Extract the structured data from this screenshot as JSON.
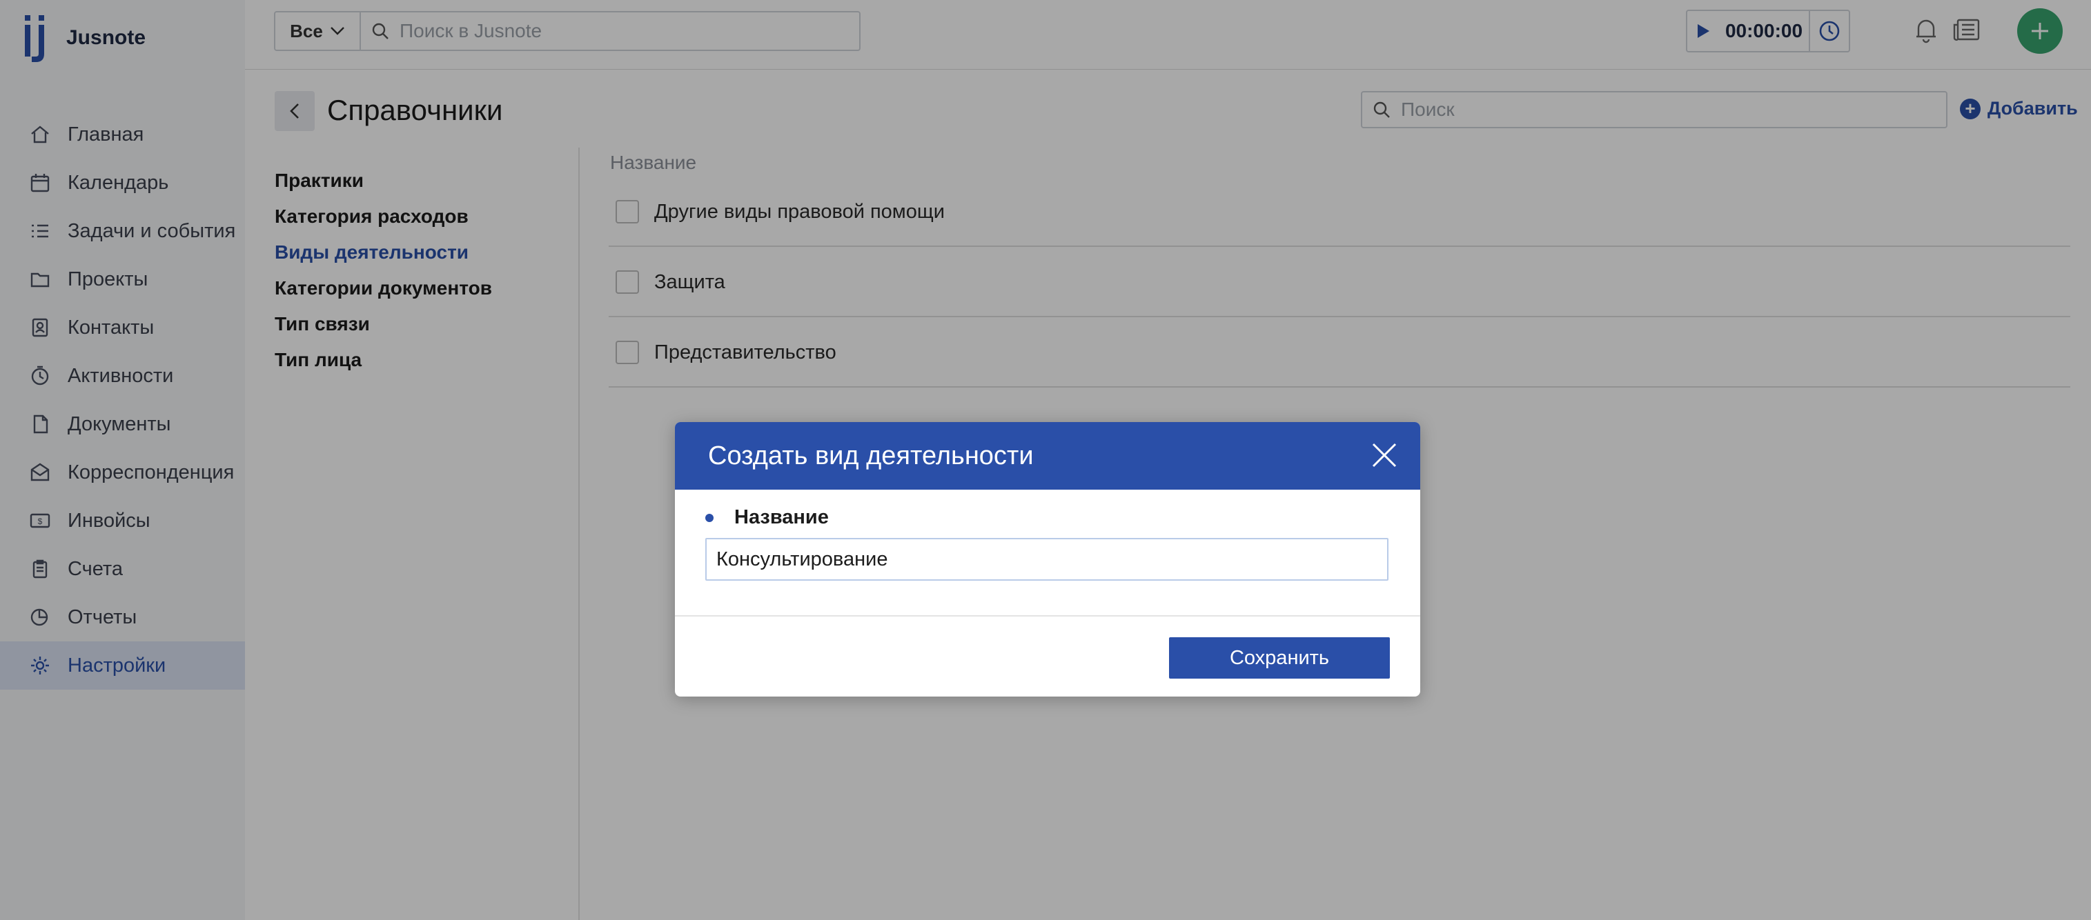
{
  "app": {
    "name": "Jusnote"
  },
  "sidebar": {
    "items": [
      {
        "label": "Главная",
        "icon": "home-icon"
      },
      {
        "label": "Календарь",
        "icon": "calendar-icon"
      },
      {
        "label": "Задачи и события",
        "icon": "tasks-icon"
      },
      {
        "label": "Проекты",
        "icon": "projects-icon"
      },
      {
        "label": "Контакты",
        "icon": "contacts-icon"
      },
      {
        "label": "Активности",
        "icon": "activity-icon"
      },
      {
        "label": "Документы",
        "icon": "documents-icon"
      },
      {
        "label": "Корреспонденция",
        "icon": "mail-icon"
      },
      {
        "label": "Инвойсы",
        "icon": "invoice-icon"
      },
      {
        "label": "Счета",
        "icon": "bills-icon"
      },
      {
        "label": "Отчеты",
        "icon": "reports-icon"
      },
      {
        "label": "Настройки",
        "icon": "gear-icon",
        "active": true
      }
    ]
  },
  "topbar": {
    "filter_label": "Все",
    "search_placeholder": "Поиск в Jusnote",
    "timer": "00:00:00"
  },
  "page": {
    "title": "Справочники",
    "search_placeholder": "Поиск",
    "add_label": "Добавить"
  },
  "references": [
    {
      "label": "Практики"
    },
    {
      "label": "Категория расходов"
    },
    {
      "label": "Виды деятельности",
      "active": true
    },
    {
      "label": "Категории документов"
    },
    {
      "label": "Тип связи"
    },
    {
      "label": "Тип лица"
    }
  ],
  "table": {
    "column": "Название",
    "rows": [
      {
        "name": "Другие виды правовой помощи"
      },
      {
        "name": "Защита"
      },
      {
        "name": "Представительство"
      }
    ]
  },
  "modal": {
    "title": "Создать вид деятельности",
    "field_label": "Название",
    "field_value": "Консультирование",
    "save_label": "Сохранить"
  },
  "colors": {
    "brand": "#2a4fa8",
    "fab": "#37a36e",
    "active_nav_bg": "#dbe3f3"
  }
}
